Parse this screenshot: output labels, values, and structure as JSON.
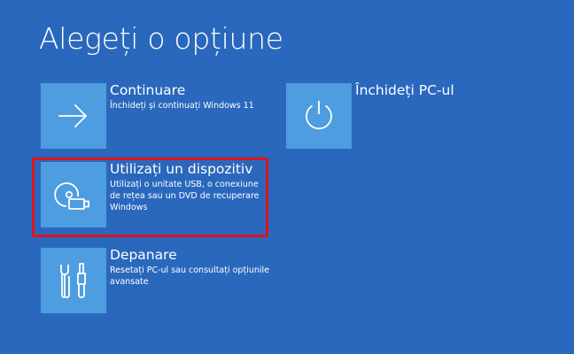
{
  "page": {
    "title": "Alegeți o opțiune"
  },
  "colors": {
    "background": "#2a68bd",
    "tile": "#4d9de0",
    "highlight": "#e0141e"
  },
  "options": [
    {
      "id": "continue",
      "title": "Continuare",
      "description": "Închideți și continuați Windows 11",
      "icon": "arrow-right-icon"
    },
    {
      "id": "shutdown",
      "title": "Închideți PC-ul",
      "description": "",
      "icon": "power-icon"
    },
    {
      "id": "use-device",
      "title": "Utilizați un dispozitiv",
      "description": "Utilizați o unitate USB, o conexiune de rețea sau un DVD de recuperare Windows",
      "icon": "disc-usb-icon",
      "highlighted": true
    },
    {
      "id": "troubleshoot",
      "title": "Depanare",
      "description": "Resetați PC-ul sau consultați opțiunile avansate",
      "icon": "tools-icon"
    }
  ]
}
